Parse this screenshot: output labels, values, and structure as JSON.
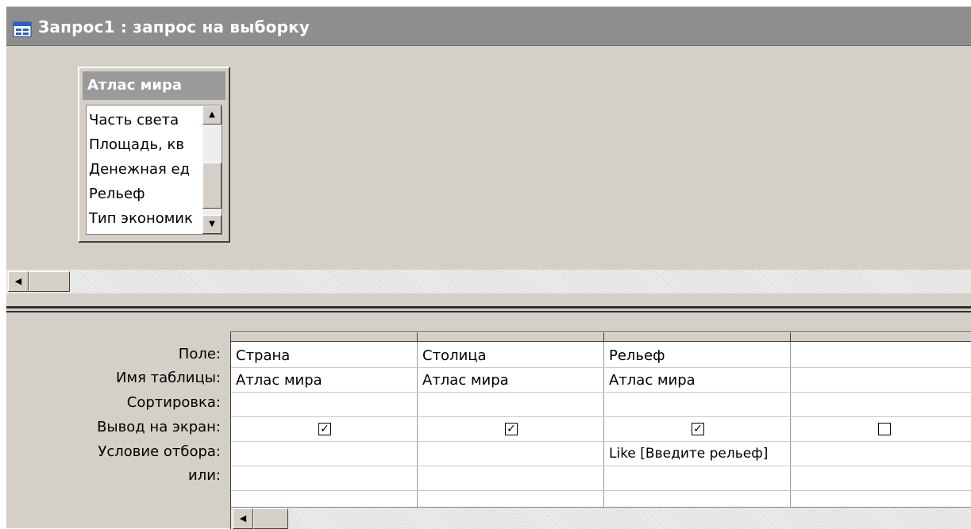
{
  "window": {
    "title": "Запрос1 : запрос на выборку"
  },
  "table_list": {
    "title": "Атлас мира",
    "fields": [
      "Часть света",
      "Площадь, кв",
      "Денежная ед",
      "Рельеф",
      "Тип экономик"
    ]
  },
  "grid": {
    "row_labels": [
      "Поле:",
      "Имя таблицы:",
      "Сортировка:",
      "Вывод на экран:",
      "Условие отбора:",
      "или:"
    ],
    "columns": [
      {
        "field": "Страна",
        "table": "Атлас мира",
        "sort": "",
        "show": true,
        "criteria": "",
        "or": ""
      },
      {
        "field": "Столица",
        "table": "Атлас мира",
        "sort": "",
        "show": true,
        "criteria": "",
        "or": ""
      },
      {
        "field": "Рельеф",
        "table": "Атлас мира",
        "sort": "",
        "show": true,
        "criteria": "Like [Введите рельеф]",
        "or": ""
      },
      {
        "field": "",
        "table": "",
        "sort": "",
        "show": false,
        "criteria": "",
        "or": ""
      }
    ]
  },
  "icons": {
    "window": "query-window-icon",
    "scroll_up": "scroll-up-arrow-icon",
    "scroll_down": "scroll-down-arrow-icon",
    "scroll_left": "scroll-left-arrow-icon",
    "check": "checkmark-icon"
  }
}
